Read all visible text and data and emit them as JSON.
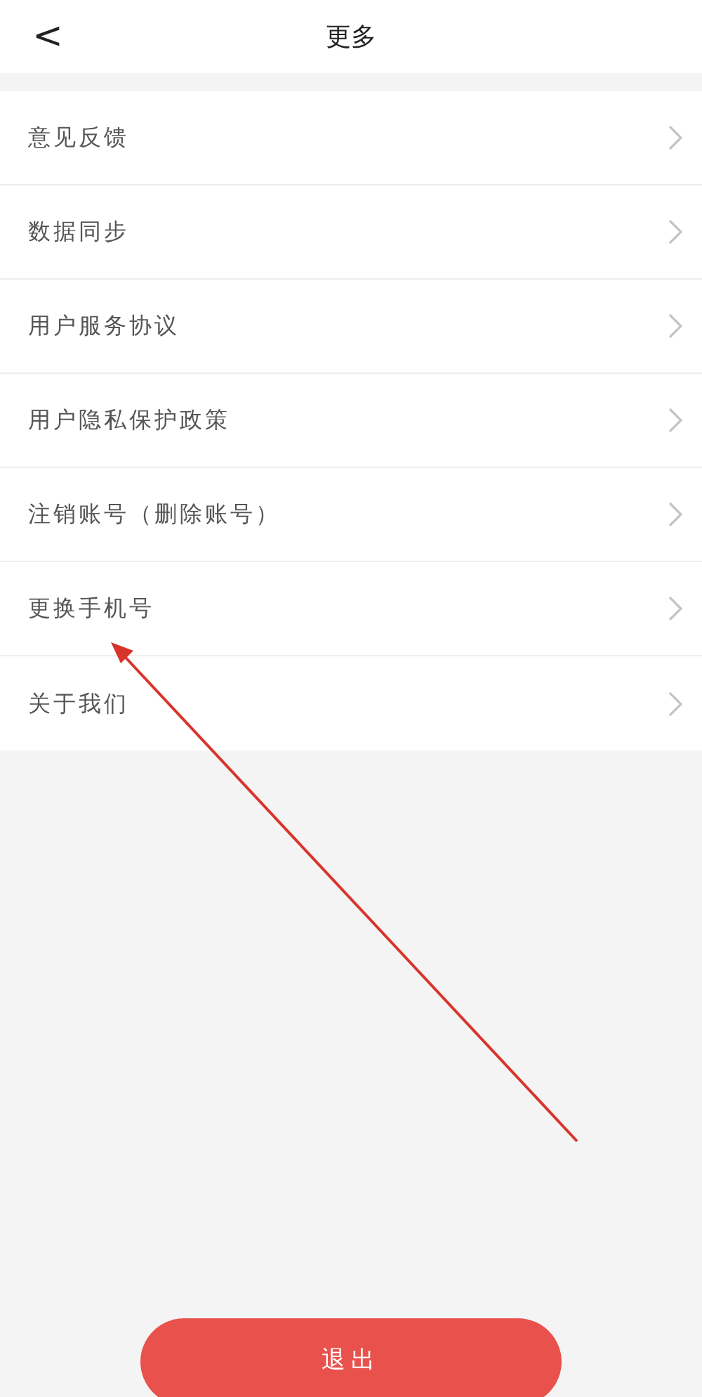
{
  "header": {
    "back_icon": "<",
    "title": "更多"
  },
  "menu": [
    {
      "label": "意见反馈"
    },
    {
      "label": "数据同步"
    },
    {
      "label": "用户服务协议"
    },
    {
      "label": "用户隐私保护政策"
    },
    {
      "label": "注销账号（删除账号）"
    },
    {
      "label": "更换手机号"
    },
    {
      "label": "关于我们"
    }
  ],
  "logout_button": {
    "label": "退出"
  }
}
